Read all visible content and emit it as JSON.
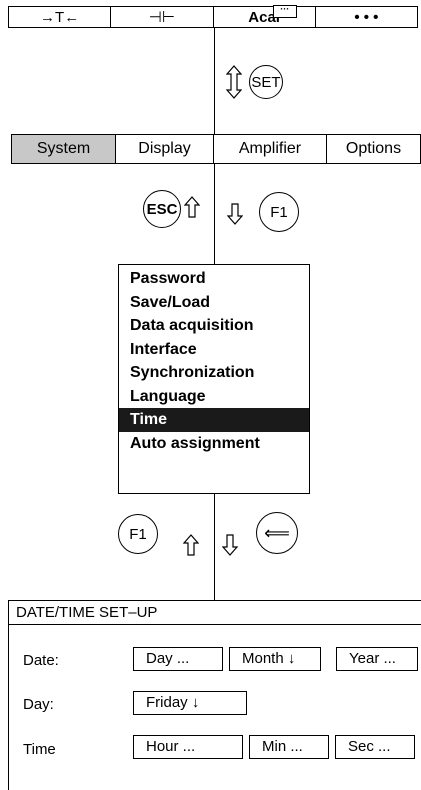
{
  "topbar": {
    "items": [
      {
        "label": "→T←",
        "icon": "tare-icon"
      },
      {
        "label": "⊣⊢",
        "icon": "zero-icon"
      },
      {
        "label": "Acal",
        "badge": "···"
      },
      {
        "label": "• • •"
      }
    ]
  },
  "tabs": {
    "items": [
      {
        "label": "System",
        "active": true
      },
      {
        "label": "Display",
        "active": false
      },
      {
        "label": "Amplifier",
        "active": false
      },
      {
        "label": "Options",
        "active": false
      }
    ]
  },
  "keys": {
    "set": "SET",
    "esc": "ESC",
    "f1_top": "F1",
    "f1_bottom": "F1",
    "enter": "⟸"
  },
  "menu": {
    "items": [
      {
        "label": "Password"
      },
      {
        "label": "Save/Load"
      },
      {
        "label": "Data acquisition"
      },
      {
        "label": "Interface"
      },
      {
        "label": "Synchronization"
      },
      {
        "label": "Language"
      },
      {
        "label": "Time",
        "selected": true
      },
      {
        "label": "Auto assignment"
      }
    ]
  },
  "dialog": {
    "title": "DATE/TIME SET–UP",
    "date_label": "Date:",
    "day_field": "Day ...",
    "month_field": "Month ↓",
    "year_field": "Year ...",
    "day_label": "Day:",
    "weekday_field": "Friday ↓",
    "time_label": "Time",
    "hour_field": "Hour ...",
    "min_field": "Min ...",
    "sec_field": "Sec ..."
  }
}
